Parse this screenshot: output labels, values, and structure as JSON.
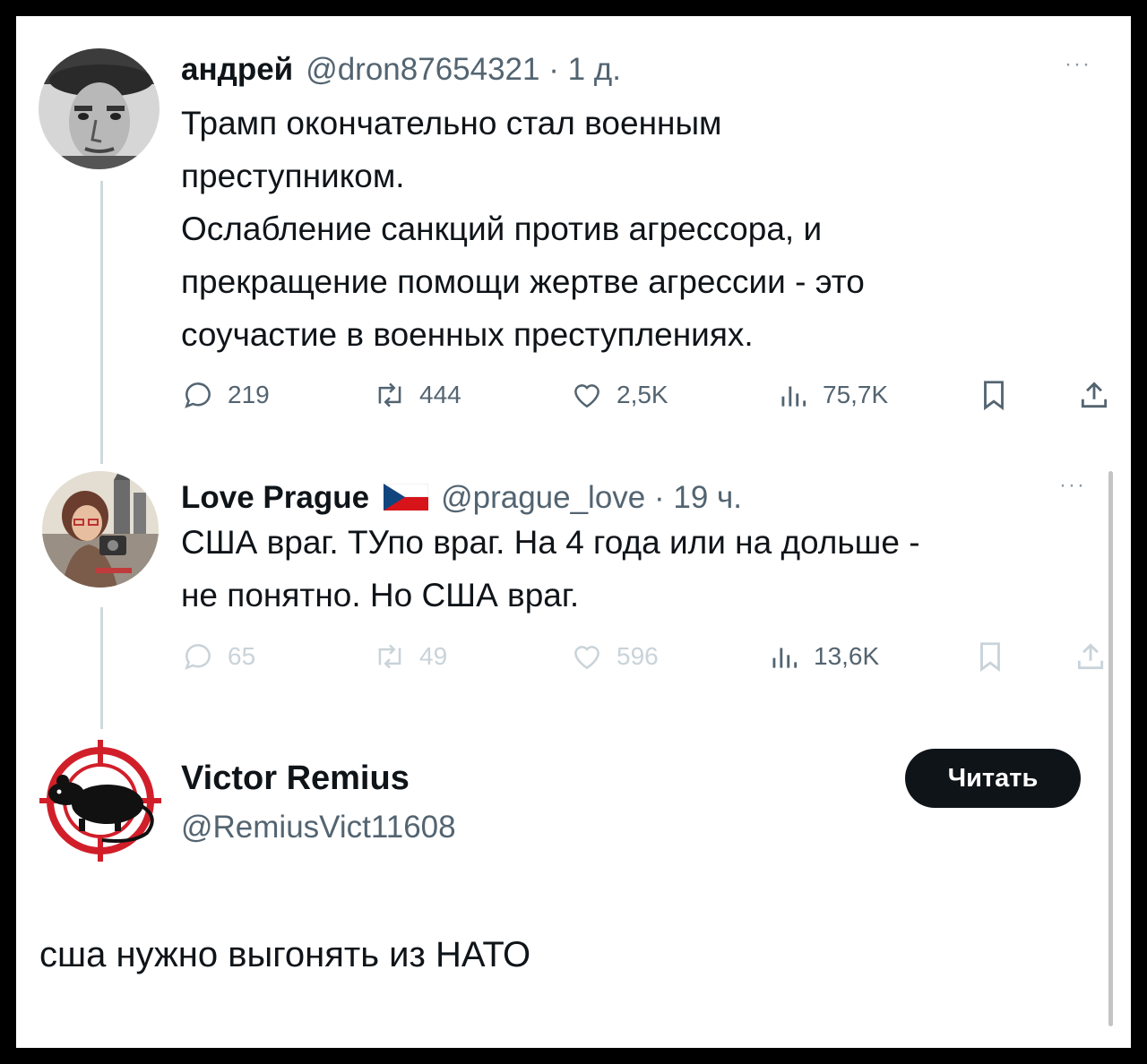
{
  "tweet1": {
    "author_name": "андрей",
    "meta": "@dron87654321 · 1 д.",
    "more_label": "···",
    "lines": [
      "Трамп окончательно стал военным",
      "преступником.",
      "Ослабление санкций против агрессора, и",
      "прекращение помощи жертве агрессии - это",
      "соучастие в военных преступлениях."
    ],
    "stats": {
      "replies": "219",
      "reposts": "444",
      "likes": "2,5K",
      "views": "75,7K"
    }
  },
  "tweet2": {
    "author_name": "Love Prague",
    "meta": "@prague_love · 19 ч.",
    "more_label": "···",
    "lines": [
      "США враг. ТУпо враг. На 4 года или на дольше -",
      "не понятно. Но США враг."
    ],
    "stats": {
      "replies": "65",
      "reposts": "49",
      "likes": "596",
      "views": "13,6K"
    }
  },
  "profile": {
    "name": "Victor Remius",
    "handle": "@RemiusVict11608",
    "follow_label": "Читать"
  },
  "standalone_text": "сша нужно выгонять из НАТО",
  "colors": {
    "text": "#0f1419",
    "muted": "#536471",
    "faded": "#c9d3d9",
    "line": "#cfd9de",
    "accent_red": "#d11f2a"
  },
  "icons": [
    "reply-icon",
    "repost-icon",
    "like-icon",
    "views-icon",
    "bookmark-icon",
    "share-icon",
    "czech-flag-icon",
    "more-icon"
  ]
}
